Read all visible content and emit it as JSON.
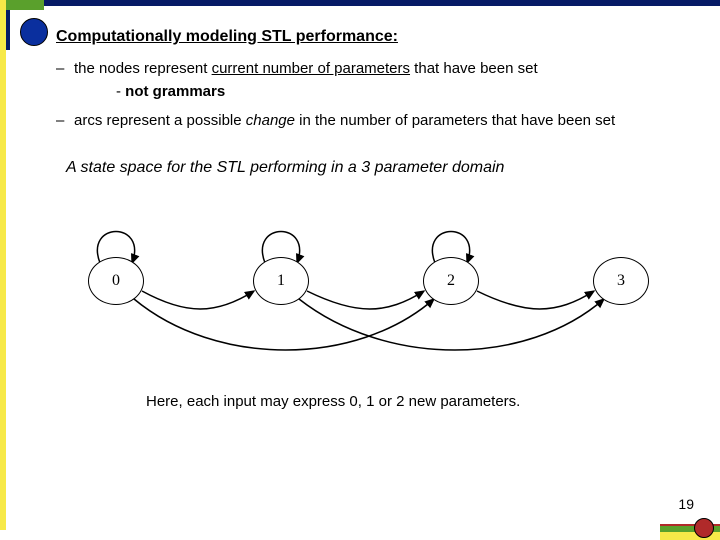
{
  "heading": "Computationally modeling STL performance:",
  "bullet1_pre": "the nodes represent ",
  "bullet1_u": "current number of parameters",
  "bullet1_post": " that have been set",
  "sub1_pre": "- ",
  "sub1_b": "not grammars",
  "bullet2_pre": "arcs represent a possible ",
  "bullet2_i": "change",
  "bullet2_post": " in the number of parameters that have been set",
  "caption": "A state space for the STL performing in a 3 parameter domain",
  "nodes": {
    "n0": "0",
    "n1": "1",
    "n2": "2",
    "n3": "3"
  },
  "footer": "Here, each input may express 0, 1 or 2 new parameters.",
  "pagenum": "19",
  "dash": "–"
}
